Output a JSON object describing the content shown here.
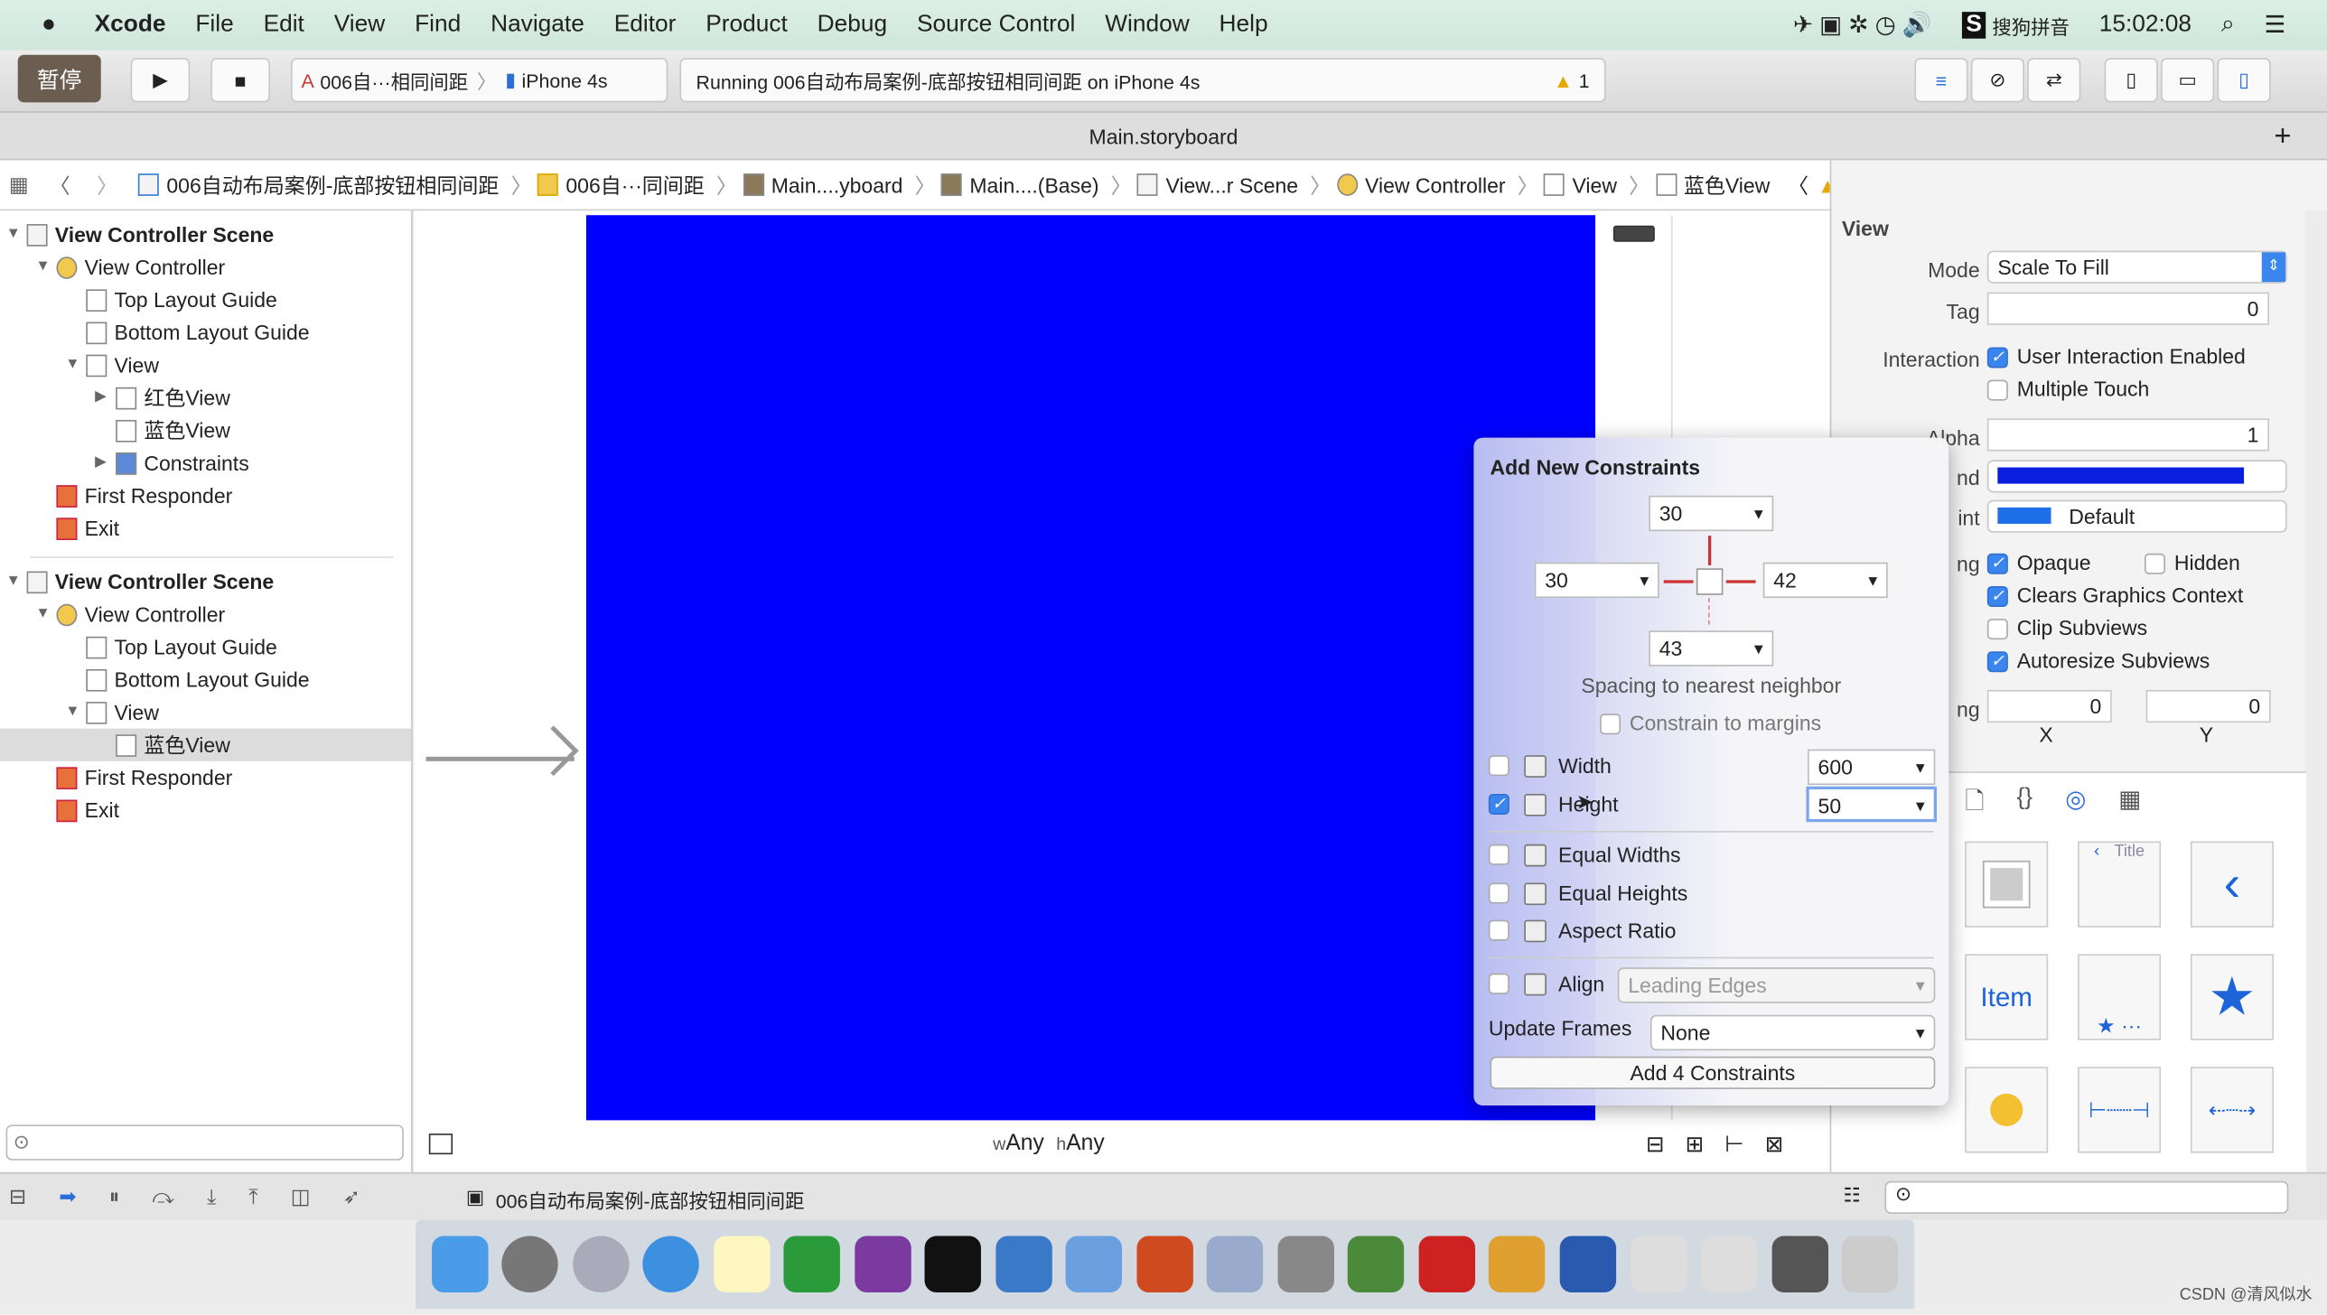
{
  "menubar": {
    "app": "Xcode",
    "items": [
      "File",
      "Edit",
      "View",
      "Find",
      "Navigate",
      "Editor",
      "Product",
      "Debug",
      "Source Control",
      "Window",
      "Help"
    ],
    "input_method": "搜狗拼音",
    "clock": "15:02:08"
  },
  "toolbar": {
    "pause_label": "暂停",
    "scheme": "006自···相同间距",
    "device": "iPhone 4s",
    "status": "Running 006自动布局案例-底部按钮相同间距 on iPhone 4s",
    "warning_count": "1"
  },
  "tab": {
    "title": "Main.storyboard"
  },
  "jumpbar": [
    "006自动布局案例-底部按钮相同间距",
    "006自···同间距",
    "Main....yboard",
    "Main....(Base)",
    "View...r Scene",
    "View Controller",
    "View",
    "蓝色View"
  ],
  "navigator": {
    "rows": [
      {
        "label": "View Controller Scene",
        "indent": 0,
        "bold": true,
        "tri": "▼"
      },
      {
        "label": "View Controller",
        "indent": 1,
        "tri": "▼"
      },
      {
        "label": "Top Layout Guide",
        "indent": 2,
        "tri": ""
      },
      {
        "label": "Bottom Layout Guide",
        "indent": 2,
        "tri": ""
      },
      {
        "label": "View",
        "indent": 2,
        "tri": "▼"
      },
      {
        "label": "红色View",
        "indent": 3,
        "tri": "▶"
      },
      {
        "label": "蓝色View",
        "indent": 3,
        "tri": ""
      },
      {
        "label": "Constraints",
        "indent": 3,
        "tri": "▶"
      },
      {
        "label": "First Responder",
        "indent": 1,
        "tri": ""
      },
      {
        "label": "Exit",
        "indent": 1,
        "tri": ""
      },
      {
        "label": "View Controller Scene",
        "indent": 0,
        "bold": true,
        "tri": "▼"
      },
      {
        "label": "View Controller",
        "indent": 1,
        "tri": "▼"
      },
      {
        "label": "Top Layout Guide",
        "indent": 2,
        "tri": ""
      },
      {
        "label": "Bottom Layout Guide",
        "indent": 2,
        "tri": ""
      },
      {
        "label": "View",
        "indent": 2,
        "tri": "▼"
      },
      {
        "label": "蓝色View",
        "indent": 3,
        "tri": "",
        "selected": true
      },
      {
        "label": "First Responder",
        "indent": 1,
        "tri": ""
      },
      {
        "label": "Exit",
        "indent": 1,
        "tri": ""
      }
    ]
  },
  "canvas": {
    "size_class_w": "w",
    "size_class_w_val": "Any",
    "size_class_h": "h",
    "size_class_h_val": "Any",
    "view_color": "#0000ff"
  },
  "popover": {
    "title": "Add New Constraints",
    "top": "30",
    "left": "30",
    "right": "42",
    "bottom": "43",
    "spacing_label": "Spacing to nearest neighbor",
    "constrain_margins": "Constrain to margins",
    "width_label": "Width",
    "width_value": "600",
    "height_label": "Height",
    "height_value": "50",
    "equal_widths": "Equal Widths",
    "equal_heights": "Equal Heights",
    "aspect_ratio": "Aspect Ratio",
    "align_label": "Align",
    "align_value": "Leading Edges",
    "update_frames_label": "Update Frames",
    "update_frames_value": "None",
    "add_button": "Add 4 Constraints"
  },
  "inspector": {
    "section": "View",
    "mode_label": "Mode",
    "mode_value": "Scale To Fill",
    "tag_label": "Tag",
    "tag_value": "0",
    "interaction_label": "Interaction",
    "user_interaction": "User Interaction Enabled",
    "multiple_touch": "Multiple Touch",
    "alpha_label": "Alpha",
    "alpha_value": "1",
    "background_label": "nd",
    "tint_label": "int",
    "tint_value": "Default",
    "drawing_label": "ng",
    "opaque": "Opaque",
    "hidden": "Hidden",
    "clears": "Clears Graphics Context",
    "clip": "Clip Subviews",
    "autoresize": "Autoresize Subviews",
    "stretching_label": "ng",
    "x_value": "0",
    "y_value": "0",
    "x_label": "X",
    "y_label": "Y",
    "background_color": "#0a1ee0",
    "tint_color": "#1f6fe8"
  },
  "library": {
    "title_item": "Title",
    "item_label": "Item"
  },
  "bottombar": {
    "target": "006自动布局案例-底部按钮相同间距"
  },
  "watermark": "CSDN @清风似水"
}
